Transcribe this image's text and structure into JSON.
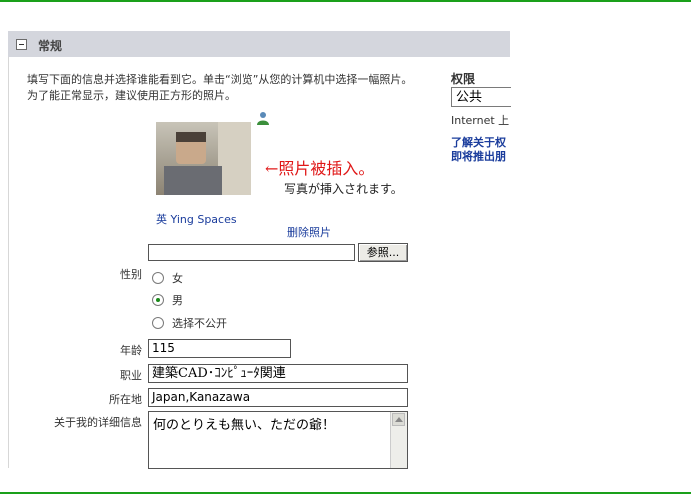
{
  "section": {
    "title": "常规"
  },
  "description": "填写下面的信息并选择谁能看到它。单击“浏览”从您的计算机中选择一幅照片。为了能正常显示，建议使用正方形的照片。",
  "permissions": {
    "title": "权限",
    "selected": "公共",
    "note": "Internet 上",
    "link_line1": "了解关于权",
    "link_line2": "即将推出朋"
  },
  "photo": {
    "annotation": "←照片被插入。",
    "annotation_jp": "写真が挿入されます。",
    "owner_link": "英 Ying Spaces",
    "delete_link": "删除照片",
    "browse_label": "参照..."
  },
  "gender": {
    "label": "性别",
    "options": [
      {
        "label": "女",
        "checked": false
      },
      {
        "label": "男",
        "checked": true
      },
      {
        "label": "选择不公开",
        "checked": false
      }
    ]
  },
  "age": {
    "label": "年龄",
    "value": "115"
  },
  "occupation": {
    "label": "职业",
    "value": "建築CAD･ｺﾝﾋﾟｭｰﾀ関連"
  },
  "location": {
    "label": "所在地",
    "value": "Japan,Kanazawa"
  },
  "about": {
    "label": "关于我的详细信息",
    "value": "何のとりえも無い、ただの爺！"
  },
  "colors": {
    "rule": "#1aa01a",
    "header_bg": "#d4d6dd",
    "link": "#1a3c9c",
    "annotation": "#e01818"
  }
}
